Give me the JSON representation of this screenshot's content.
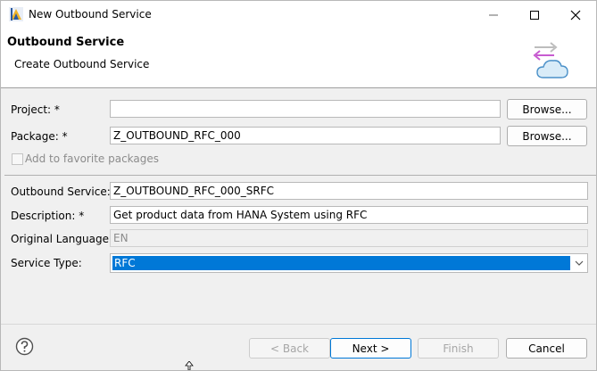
{
  "window": {
    "title": "New Outbound Service"
  },
  "banner": {
    "title": "Outbound Service",
    "subtitle": "Create Outbound Service"
  },
  "form": {
    "project_label": "Project: *",
    "project_value": "",
    "browse_label": "Browse...",
    "package_label": "Package: *",
    "package_value": "Z_OUTBOUND_RFC_000",
    "favorite_label": "Add to favorite packages",
    "outbound_label": "Outbound Service: *",
    "outbound_value": "Z_OUTBOUND_RFC_000_SRFC",
    "description_label": "Description: *",
    "description_value": "Get product data from HANA System using RFC",
    "language_label": "Original Language:",
    "language_value": "EN",
    "service_type_label": "Service Type:",
    "service_type_value": "RFC"
  },
  "buttons": {
    "back": "< Back",
    "next": "Next >",
    "finish": "Finish",
    "cancel": "Cancel"
  },
  "colors": {
    "accent": "#0078d7"
  }
}
